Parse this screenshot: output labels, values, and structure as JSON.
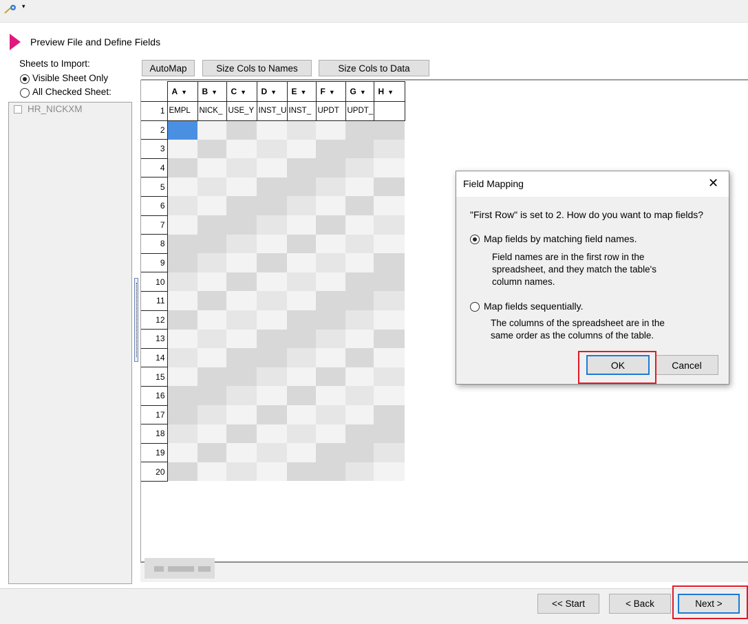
{
  "toolbar": {
    "wizard_icon": "wizard-wand-icon",
    "menu_caret": "▾"
  },
  "step": {
    "title": "Preview File and Define Fields"
  },
  "sheets_panel": {
    "label": "Sheets to Import:",
    "options": [
      "Visible Sheet Only",
      "All Checked Sheet:"
    ],
    "selected": "Visible Sheet Only",
    "sheets": [
      "HR_NICKXM"
    ]
  },
  "grid_toolbar": {
    "automap": "AutoMap",
    "size_names": "Size Cols to Names",
    "size_data": "Size Cols to Data"
  },
  "grid": {
    "columns": [
      "A",
      "B",
      "C",
      "D",
      "E",
      "F",
      "G",
      "H"
    ],
    "header_row": [
      "EMPL",
      "NICK_",
      "USE_Y",
      "INST_U",
      "INST_",
      "UPDT",
      "UPDT_",
      ""
    ],
    "rows": [
      "1",
      "2",
      "3",
      "4",
      "5",
      "6",
      "7",
      "8",
      "9",
      "10",
      "11",
      "12",
      "13",
      "14",
      "15",
      "16",
      "17",
      "18",
      "19",
      "20"
    ]
  },
  "dialog": {
    "title": "Field Mapping",
    "message": "\"First Row\" is set to 2.  How do you want to map fields?",
    "option1_label": "Map fields by matching field names.",
    "option1_desc1": "Field names are in the first row in the",
    "option1_desc2": "spreadsheet, and they match the table's",
    "option1_desc3": "column names.",
    "option2_label": "Map fields sequentially.",
    "option2_desc1": "The columns of the spreadsheet are in the",
    "option2_desc2": "same order as the columns of the table.",
    "ok": "OK",
    "cancel": "Cancel",
    "close": "✕"
  },
  "nav": {
    "start": "<< Start",
    "back": "< Back",
    "next": "Next >"
  },
  "colors": {
    "accent_arrow": "#e0197d",
    "highlight_box": "#e0192a",
    "default_button": "#1e79d0"
  }
}
